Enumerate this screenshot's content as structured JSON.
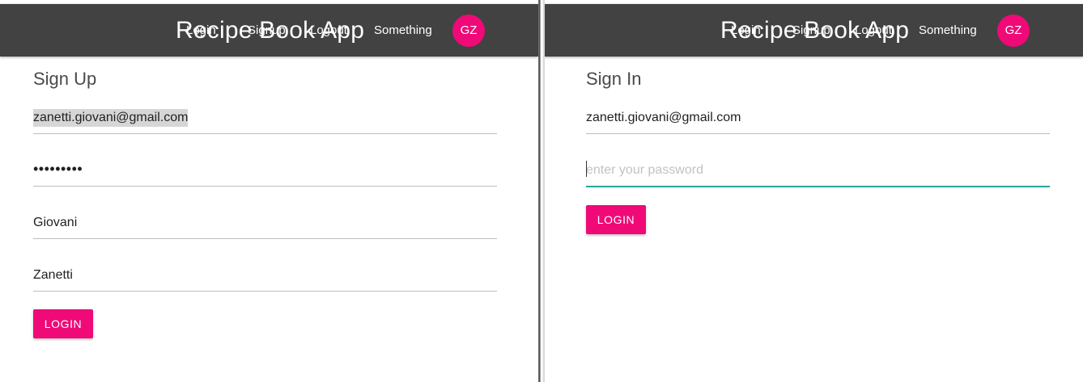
{
  "app": {
    "title": "Recipe Book App",
    "nav": {
      "login": "Login",
      "signup": "Signup",
      "logout": "Logout",
      "something": "Something"
    },
    "avatar_initials": "GZ",
    "colors": {
      "appbar": "#424242",
      "accent": "#ef0a78",
      "focus_underline": "#26a69a"
    }
  },
  "signup_form": {
    "title": "Sign Up",
    "email_value": "zanetti.giovani@gmail.com",
    "password_masked": "•••••••••",
    "first_name_value": "Giovani",
    "last_name_value": "Zanetti",
    "submit_label": "LOGIN"
  },
  "signin_form": {
    "title": "Sign In",
    "email_value": "zanetti.giovani@gmail.com",
    "password_placeholder": "enter your password",
    "submit_label": "LOGIN"
  }
}
